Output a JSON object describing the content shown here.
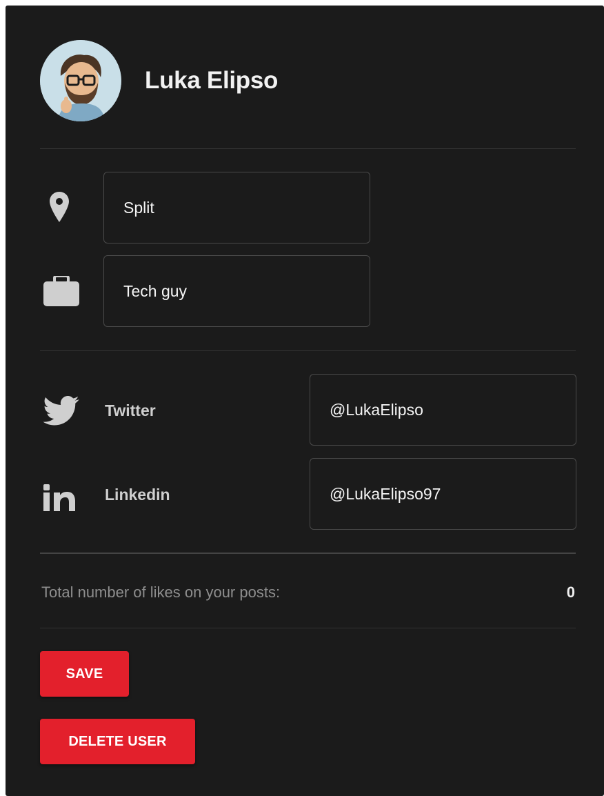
{
  "profile": {
    "name": "Luka Elipso",
    "avatar_icon": "avatar-icon"
  },
  "details": {
    "location": {
      "icon": "location-pin-icon",
      "value": "Split"
    },
    "occupation": {
      "icon": "briefcase-icon",
      "value": "Tech guy"
    }
  },
  "social": {
    "twitter": {
      "icon": "twitter-icon",
      "label": "Twitter",
      "value": "@LukaElipso"
    },
    "linkedin": {
      "icon": "linkedin-icon",
      "label": "Linkedin",
      "value": "@LukaElipso97"
    }
  },
  "stats": {
    "likes_label": "Total number of likes on your posts:",
    "likes_value": "0"
  },
  "actions": {
    "save_label": "SAVE",
    "delete_label": "DELETE USER"
  },
  "colors": {
    "background": "#1b1b1b",
    "accent": "#e3202c",
    "icon": "#cfcfcf",
    "border": "#4a4a4a"
  }
}
